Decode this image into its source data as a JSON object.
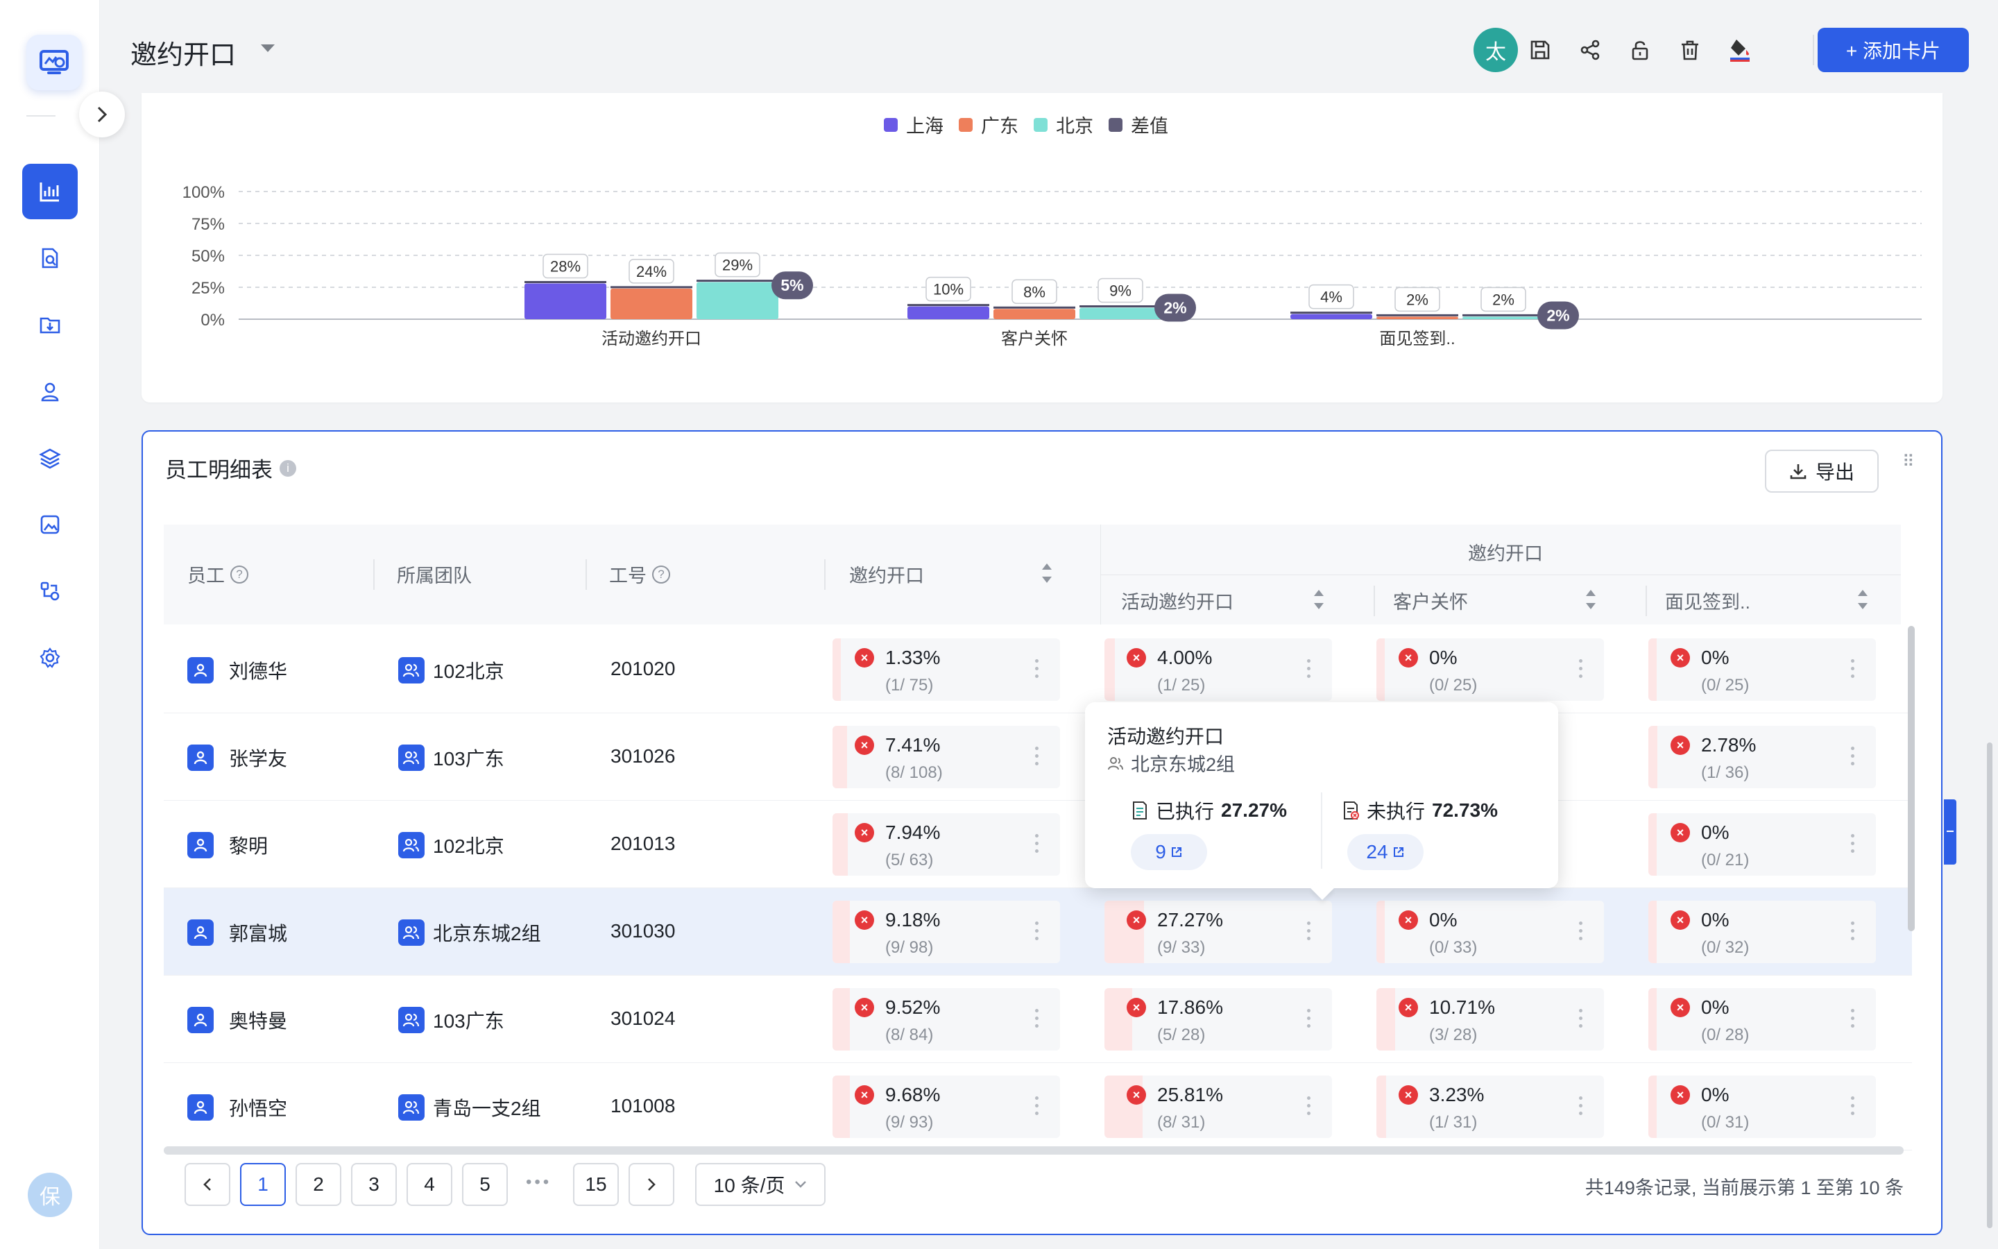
{
  "sidebar": {
    "avatar_label": "保"
  },
  "header": {
    "title": "邀约开口",
    "avatar_label": "太",
    "add_card_label": "+ 添加卡片"
  },
  "chart_data": {
    "type": "bar",
    "categories": [
      "活动邀约开口",
      "客户关怀",
      "面见签到.."
    ],
    "series": [
      {
        "name": "上海",
        "values": [
          28,
          10,
          4
        ]
      },
      {
        "name": "广东",
        "values": [
          24,
          8,
          2
        ]
      },
      {
        "name": "北京",
        "values": [
          29,
          9,
          2
        ]
      }
    ],
    "diff": {
      "name": "差值",
      "values": [
        5,
        2,
        2
      ]
    },
    "value_labels": {
      "上海": [
        "28%",
        "10%",
        "4%"
      ],
      "广东": [
        "24%",
        "8%",
        "2%"
      ],
      "北京": [
        "29%",
        "9%",
        "2%"
      ],
      "差值": [
        "5%",
        "2%",
        "2%"
      ]
    },
    "yticks": [
      "100%",
      "75%",
      "50%",
      "25%",
      "0%"
    ],
    "ylim": [
      0,
      100
    ],
    "grid": true,
    "legend": "top-center",
    "colors": {
      "上海": "#6b5ae6",
      "广东": "#ee7f5b",
      "北京": "#7fe0d6",
      "差值": "#5f5c78"
    }
  },
  "table": {
    "title": "员工明细表",
    "export_label": "导出",
    "headers": {
      "employee": "员工",
      "team": "所属团队",
      "id": "工号",
      "invite": "邀约开口",
      "group": "邀约开口",
      "activity": "活动邀约开口",
      "care": "客户关怀",
      "visit": "面见签到.."
    },
    "rows": [
      {
        "name": "刘德华",
        "team": "102北京",
        "id": "201020",
        "m": [
          {
            "v": "1.33%",
            "f": "(1/ 75)",
            "p": 1.33
          },
          {
            "v": "4.00%",
            "f": "(1/ 25)",
            "p": 4.0
          },
          {
            "v": "0%",
            "f": "(0/ 25)",
            "p": 0
          },
          {
            "v": "0%",
            "f": "(0/ 25)",
            "p": 0
          }
        ]
      },
      {
        "name": "张学友",
        "team": "103广东",
        "id": "301026",
        "m": [
          {
            "v": "7.41%",
            "f": "(8/ 108)",
            "p": 7.41
          },
          {
            "v": "",
            "f": "",
            "p": 0
          },
          {
            "v": "",
            "f": "",
            "p": 0
          },
          {
            "v": "2.78%",
            "f": "(1/ 36)",
            "p": 2.78
          }
        ]
      },
      {
        "name": "黎明",
        "team": "102北京",
        "id": "201013",
        "m": [
          {
            "v": "7.94%",
            "f": "(5/ 63)",
            "p": 7.94
          },
          {
            "v": "",
            "f": "",
            "p": 0
          },
          {
            "v": "",
            "f": "",
            "p": 0
          },
          {
            "v": "0%",
            "f": "(0/ 21)",
            "p": 0
          }
        ]
      },
      {
        "name": "郭富城",
        "team": "北京东城2组",
        "id": "301030",
        "m": [
          {
            "v": "9.18%",
            "f": "(9/ 98)",
            "p": 9.18
          },
          {
            "v": "27.27%",
            "f": "(9/ 33)",
            "p": 27.27
          },
          {
            "v": "0%",
            "f": "(0/ 33)",
            "p": 0
          },
          {
            "v": "0%",
            "f": "(0/ 32)",
            "p": 0
          }
        ]
      },
      {
        "name": "奥特曼",
        "team": "103广东",
        "id": "301024",
        "m": [
          {
            "v": "9.52%",
            "f": "(8/ 84)",
            "p": 9.52
          },
          {
            "v": "17.86%",
            "f": "(5/ 28)",
            "p": 17.86
          },
          {
            "v": "10.71%",
            "f": "(3/ 28)",
            "p": 10.71
          },
          {
            "v": "0%",
            "f": "(0/ 28)",
            "p": 0
          }
        ]
      },
      {
        "name": "孙悟空",
        "team": "青岛一支2组",
        "id": "101008",
        "m": [
          {
            "v": "9.68%",
            "f": "(9/ 93)",
            "p": 9.68
          },
          {
            "v": "25.81%",
            "f": "(8/ 31)",
            "p": 25.81
          },
          {
            "v": "3.23%",
            "f": "(1/ 31)",
            "p": 3.23
          },
          {
            "v": "0%",
            "f": "(0/ 31)",
            "p": 0
          }
        ]
      }
    ]
  },
  "tooltip": {
    "title": "活动邀约开口",
    "team": "北京东城2组",
    "done_label": "已执行",
    "done_value": "27.27%",
    "done_count": "9",
    "todo_label": "未执行",
    "todo_value": "72.73%",
    "todo_count": "24"
  },
  "pagination": {
    "pages": [
      "1",
      "2",
      "3",
      "4",
      "5"
    ],
    "ellipsis": "•••",
    "last": "15",
    "current": "1",
    "page_size": "10 条/页",
    "summary": "共149条记录, 当前展示第 1 至第 10 条"
  }
}
